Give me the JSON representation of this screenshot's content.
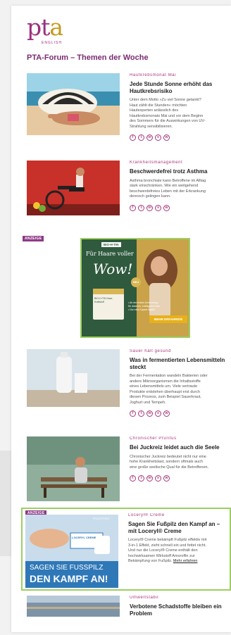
{
  "header": {
    "logo_text_pt": "pt",
    "logo_text_a": "a",
    "logo_sub": "ENGLISH",
    "page_title": "PTA-Forum – Themen der Woche"
  },
  "articles": [
    {
      "kicker": "Hautkrebsmonat Mai",
      "headline": [
        "Jede Stunde Sonne erhöht das",
        "Hautkrebsrisiko"
      ],
      "teaser": [
        "Unter dem Motto »Zu viel Sonne getankt?",
        "Haut zählt die Stunden« möchten",
        "Hautexperten anlässlich des",
        "Hautkrebsmonats Mai und vor dem Beginn",
        "des Sommers für die Auswirkungen von UV-",
        "Strahlung sensibilisieren."
      ]
    },
    {
      "kicker": "Krankheitsmanagement",
      "headline": [
        "Beschwerdefrei trotz Asthma"
      ],
      "teaser": [
        "Asthma bronchiale kann Betroffene im Alltag",
        "stark einschränken. Wie ein weitgehend",
        "beschwerdefreies Leben mit der Erkrankung",
        "dennoch gelingen kann."
      ]
    },
    {
      "kicker": "Sauer hält gesund",
      "headline": [
        "Was in fermentierten Lebensmitteln",
        "steckt"
      ],
      "teaser": [
        "Bei der Fermentation wandeln Bakterien oder",
        "andere Mikroorganismen die Inhaltsstoffe",
        "eines Lebensmittels um. Viele vertraute",
        "Produkte entstehen überhaupt erst durch",
        "diesen Prozess, zum Beispiel Sauerkraut,",
        "Joghurt und Tempeh."
      ]
    },
    {
      "kicker": "Chronischer Pruritus",
      "headline": [
        "Bei Juckreiz leidet auch die Seele"
      ],
      "teaser": [
        "Chronischer Juckreiz bedeutet nicht nur eine",
        "hohe Krankheitslast, sondern oftmals auch",
        "eine große seelische Qual für die Betroffenen."
      ]
    },
    {
      "kicker": "Umweltstabil",
      "headline": [
        "Verbotene Schadstoffe bleiben ein",
        "Problem"
      ],
      "teaser": []
    }
  ],
  "ad_hair": {
    "label": "ANZEIGE",
    "brand": "BIO-H-TIN",
    "tagline": "Für Haare voller",
    "wow": "Wow!",
    "badge": "NEU",
    "product": "BIO-H-TIN Haar-Kraftstoff",
    "bullets": [
      "• Ab der ersten Anwendung",
      "  für dickeres, kräftigeres Haar",
      "• Nur eine Kapsel täglich"
    ],
    "cta": "MEHR ERFAHREN!"
  },
  "ad_loceryl": {
    "label": "ANZEIGE",
    "kicker": "Loceryl® Creme",
    "headline": [
      "Sagen Sie Fußpilz den Kampf an –",
      "mit Loceryl® Creme"
    ],
    "teaser": [
      "Loceryl® Creme bekämpft Fußpilz effektiv mit",
      "3-in-1 Effekt, zieht schnell ein und fettet nicht.",
      "Und nur die Loceryl® Creme enthält den",
      "hochwirksamen Wirkstoff Amorolfin zur",
      "Bekämpfung von Fußpilz."
    ],
    "more": "Mehr erfahren",
    "banner_top": "SAGEN SIE FUSSPILZ",
    "banner_bottom": "DEN KAMPF AN!",
    "product": "LOCERYL CREME",
    "pflicht": "PFLICHTTEXT"
  },
  "share_icons": [
    "facebook-icon",
    "twitter-icon",
    "linkedin-icon",
    "xing-icon",
    "whatsapp-icon"
  ],
  "colors": {
    "brand": "#9b2f7f",
    "accent": "#c59a1f",
    "ad_border": "#9ccf62",
    "kicker": "#a8367a"
  }
}
